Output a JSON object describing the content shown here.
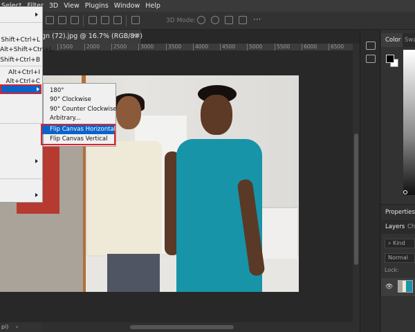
{
  "menubar": {
    "items": [
      "Select",
      "Filter",
      "3D",
      "View",
      "Plugins",
      "Window",
      "Help"
    ]
  },
  "options_bar": {
    "mode_label": "3D Mode:",
    "more": "···"
  },
  "document": {
    "tab_title": "gn (72).jpg @ 16.7% (RGB/8#)",
    "close": "×"
  },
  "ruler": {
    "ticks": [
      "1500",
      "2000",
      "2500",
      "3000",
      "3500",
      "4000",
      "4500",
      "5000",
      "5500",
      "6000",
      "6500"
    ]
  },
  "status": {
    "zoom": "pi)"
  },
  "image_menu": {
    "shortcuts": [
      "Shift+Ctrl+L",
      "Alt+Shift+Ctrl+L",
      "Shift+Ctrl+B",
      "Alt+Ctrl+I",
      "Alt+Ctrl+C"
    ]
  },
  "rotation_submenu": {
    "items": [
      "180°",
      "90° Clockwise",
      "90° Counter Clockwise",
      "Arbitrary..."
    ],
    "flip_horizontal": "Flip Canvas Horizontal",
    "flip_vertical": "Flip Canvas Vertical"
  },
  "panels": {
    "color_tab": "Color",
    "swatches_tab": "Swa",
    "properties": "Properties",
    "layers_tab": "Layers",
    "channels_tab": "Ch",
    "kind": "Kind",
    "blend_mode": "Normal",
    "lock": "Lock:"
  },
  "colors": {
    "highlight": "#0a64c8",
    "annotation": "#d9232e",
    "dress": "#1794a8"
  }
}
